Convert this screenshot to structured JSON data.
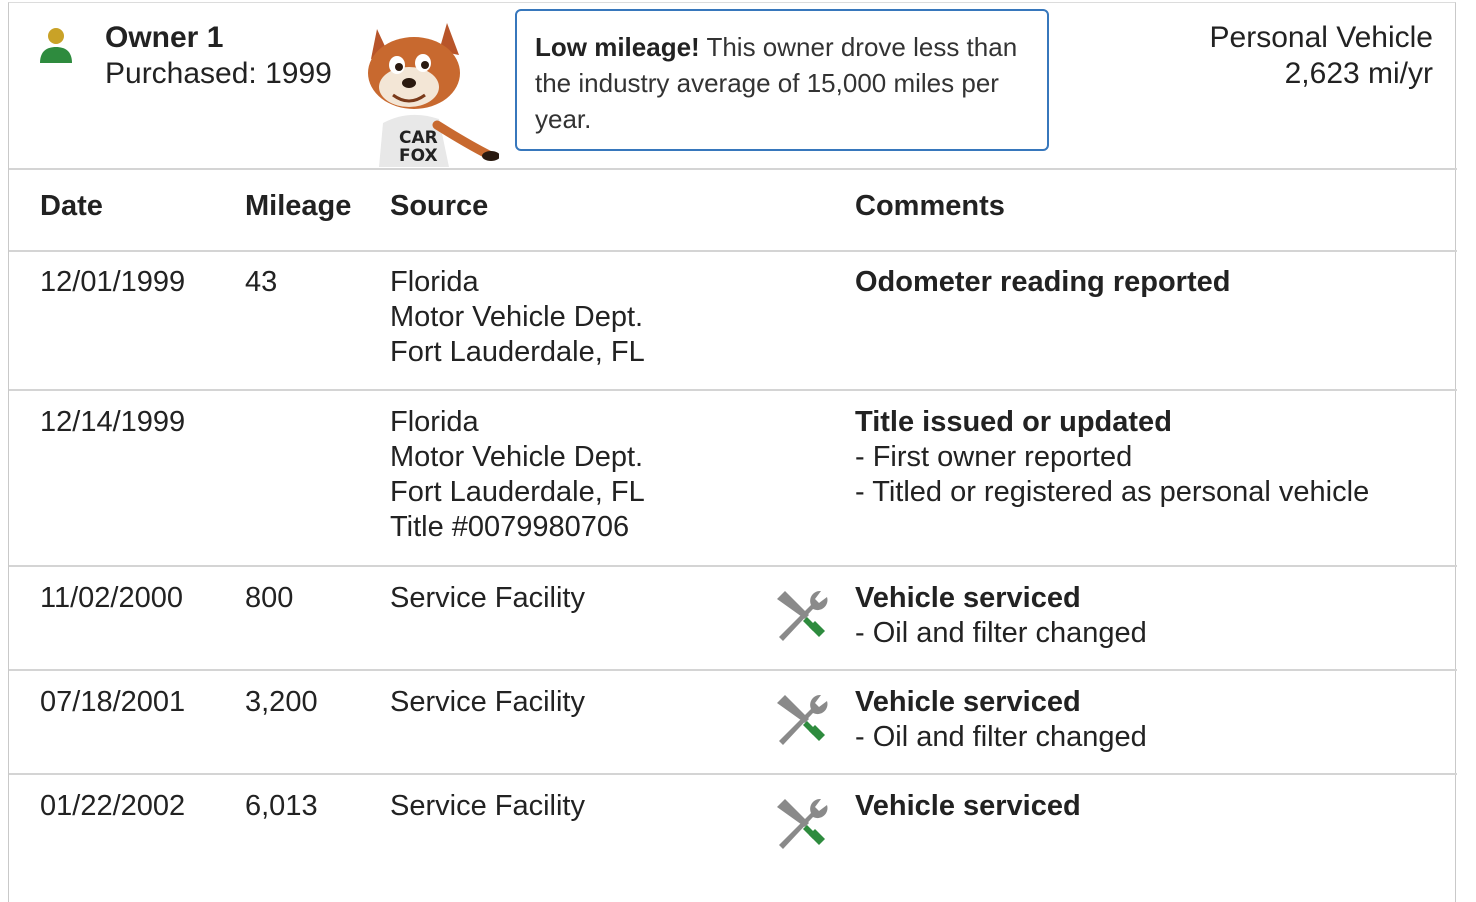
{
  "owner": {
    "title": "Owner 1",
    "purchased": "Purchased: 1999",
    "usage_type": "Personal Vehicle",
    "miles_per_year": "2,623 mi/yr",
    "icon": "person-icon",
    "mascot": "carfox-mascot",
    "mascot_shirt_line1": "CAR",
    "mascot_shirt_line2": "FOX"
  },
  "callout": {
    "bold": "Low mileage!",
    "text": " This owner drove less than the industry average of 15,000 miles per year."
  },
  "table": {
    "headers": {
      "date": "Date",
      "mileage": "Mileage",
      "source": "Source",
      "comments": "Comments"
    },
    "rows": [
      {
        "date": "12/01/1999",
        "mileage": "43",
        "source": [
          "Florida",
          "Motor Vehicle Dept.",
          "Fort Lauderdale, FL"
        ],
        "icon": "",
        "comment_title": "Odometer reading reported",
        "comment_lines": []
      },
      {
        "date": "12/14/1999",
        "mileage": "",
        "source": [
          "Florida",
          "Motor Vehicle Dept.",
          "Fort Lauderdale, FL",
          "Title #0079980706"
        ],
        "icon": "",
        "comment_title": "Title issued or updated",
        "comment_lines": [
          "- First owner reported",
          "- Titled or registered as personal vehicle"
        ]
      },
      {
        "date": "11/02/2000",
        "mileage": "800",
        "source": [
          "Service Facility"
        ],
        "icon": "wrench-screwdriver-icon",
        "comment_title": "Vehicle serviced",
        "comment_lines": [
          "- Oil and filter changed"
        ]
      },
      {
        "date": "07/18/2001",
        "mileage": "3,200",
        "source": [
          "Service Facility"
        ],
        "icon": "wrench-screwdriver-icon",
        "comment_title": "Vehicle serviced",
        "comment_lines": [
          "- Oil and filter changed"
        ]
      },
      {
        "date": "01/22/2002",
        "mileage": "6,013",
        "source": [
          "Service Facility"
        ],
        "icon": "wrench-screwdriver-icon",
        "comment_title": "Vehicle serviced",
        "comment_lines": []
      }
    ]
  },
  "colors": {
    "callout_border": "#3777bc",
    "person_head": "#c9a227",
    "person_body": "#2e8b3e",
    "tool_gray": "#8a8a8a",
    "tool_green": "#2e8b3e"
  }
}
